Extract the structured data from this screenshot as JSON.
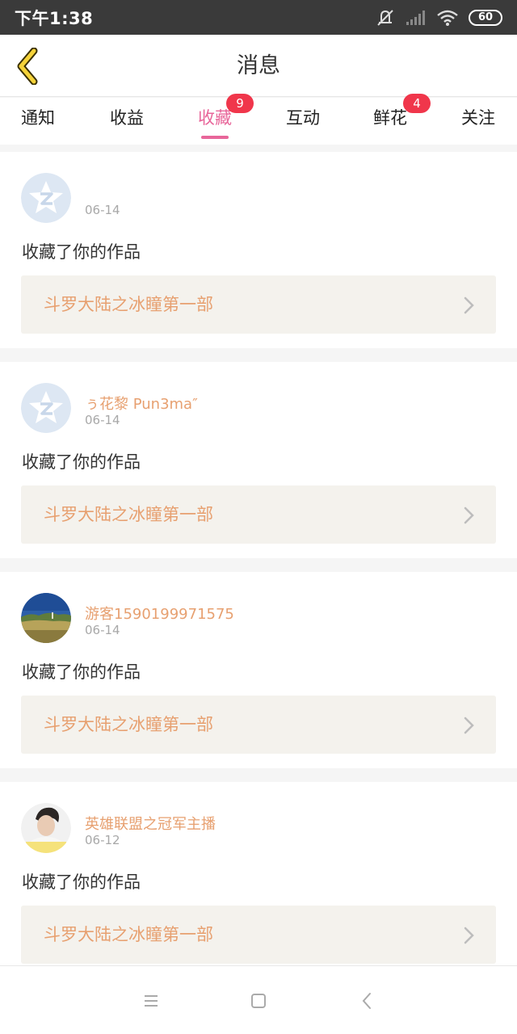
{
  "status_bar": {
    "time": "下午1:38",
    "battery": "60",
    "icons": [
      "mute-icon",
      "signal-icon",
      "wifi-icon",
      "battery-icon"
    ]
  },
  "header": {
    "title": "消息",
    "back_icon": "chevron-left-icon"
  },
  "tabs": [
    {
      "label": "通知",
      "badge": "",
      "active": false
    },
    {
      "label": "收益",
      "badge": "",
      "active": false
    },
    {
      "label": "收藏",
      "badge": "9",
      "active": true
    },
    {
      "label": "互动",
      "badge": "",
      "active": false
    },
    {
      "label": "鲜花",
      "badge": "4",
      "active": false
    },
    {
      "label": "关注",
      "badge": "",
      "active": false
    }
  ],
  "colors": {
    "accent": "#e8669a",
    "badge": "#f0364b",
    "link_text": "#e7a070",
    "link_bg": "#f4f2ed"
  },
  "feed": [
    {
      "avatar": "default-qzone-avatar",
      "username": "",
      "date": "06-14",
      "message": "收藏了你的作品",
      "work_title": "斗罗大陆之冰瞳第一部"
    },
    {
      "avatar": "default-qzone-avatar",
      "username": "ぅ花黎 Pun3ma″",
      "date": "06-14",
      "message": "收藏了你的作品",
      "work_title": "斗罗大陆之冰瞳第一部"
    },
    {
      "avatar": "landscape-photo-avatar",
      "username": "游客1590199971575",
      "date": "06-14",
      "message": "收藏了你的作品",
      "work_title": "斗罗大陆之冰瞳第一部"
    },
    {
      "avatar": "person-photo-avatar",
      "username": "英雄联盟之冠军主播",
      "date": "06-12",
      "message": "收藏了你的作品",
      "work_title": "斗罗大陆之冰瞳第一部"
    }
  ],
  "nav_bar": {
    "icons": [
      "menu-icon",
      "home-square-icon",
      "back-triangle-icon"
    ]
  }
}
